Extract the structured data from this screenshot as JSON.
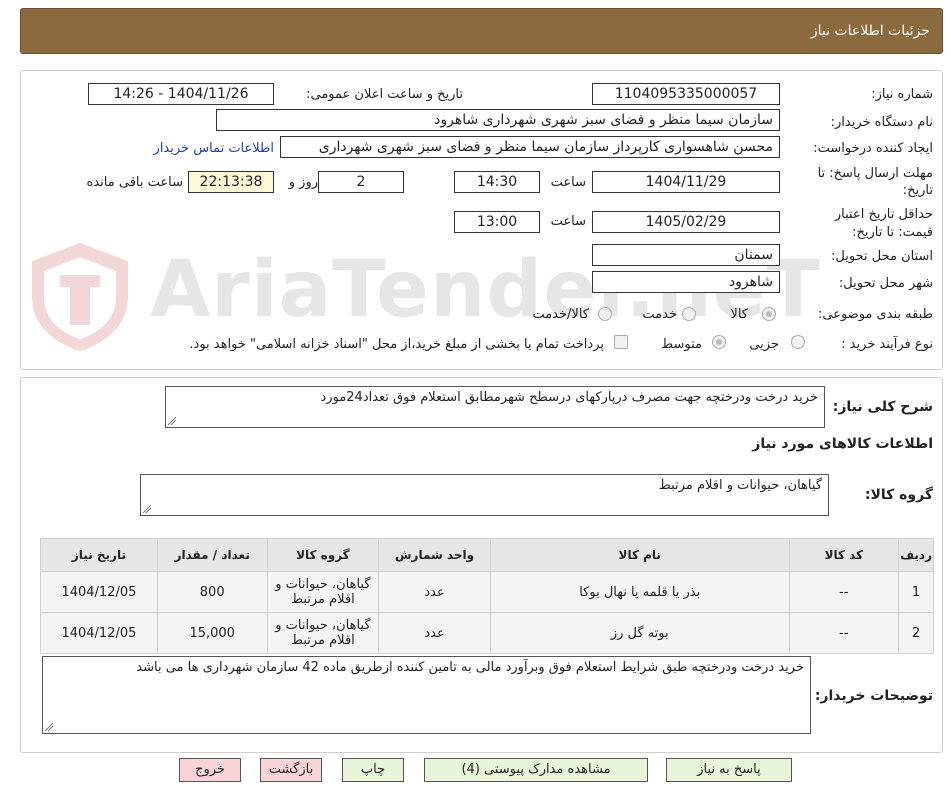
{
  "header": {
    "title": "جزئیات اطلاعات نیاز"
  },
  "form": {
    "need_number_label": "شماره نیاز:",
    "need_number": "1104095335000057",
    "announce_label": "تاریخ و ساعت اعلان عمومی:",
    "announce_value": "1404/11/26 - 14:26",
    "buyer_org_label": "نام دستگاه خریدار:",
    "buyer_org": "سازمان سیما منظر و فضای سبز شهری شهرداری شاهرود",
    "creator_label": "ایجاد کننده درخواست:",
    "creator": "محسن شاهسواری کارپرداز سازمان سیما منظر و فضای سبز شهری شهرداری",
    "contact_link": "اطلاعات تماس خریدار",
    "deadline_label_1": "مهلت ارسال پاسخ: تا",
    "deadline_label_2": "تاریخ:",
    "deadline_date": "1404/11/29",
    "time_label": "ساعت",
    "deadline_time": "14:30",
    "days_value": "2",
    "days_label": "روز و",
    "remaining_time": "22:13:38",
    "remaining_label": "ساعت باقی مانده",
    "validity_label_1": "حداقل تاریخ اعتبار",
    "validity_label_2": "قیمت: تا تاریخ:",
    "validity_date": "1405/02/29",
    "validity_time_label": "ساعت",
    "validity_time": "13:00",
    "province_label": "استان محل تحویل:",
    "province": "سمنان",
    "city_label": "شهر محل تحویل:",
    "city": "شاهرود",
    "category_label": "طبقه بندی موضوعی:",
    "category_options": [
      "کالا",
      "خدمت",
      "کالا/خدمت"
    ],
    "category_selected": "کالا",
    "process_label": "نوع فرآیند خرید :",
    "process_options": [
      "جزیی",
      "متوسط"
    ],
    "process_selected": "متوسط",
    "payment_note": "پرداخت تمام یا بخشی از مبلغ خرید،از محل \"اسناد خزانه اسلامی\" خواهد بود."
  },
  "summary": {
    "label": "شرح کلی نیاز:",
    "text": "خرید درخت ودرختچه جهت مصرف درپارکهای درسطح شهرمطابق استعلام فوق تعداد24مورد"
  },
  "goods": {
    "section_title": "اطلاعات کالاهای مورد نیاز",
    "group_label": "گروه کالا:",
    "group_value": "گیاهان، حیوانات و اقلام مرتبط"
  },
  "table": {
    "headers": [
      "ردیف",
      "کد کالا",
      "نام کالا",
      "واحد شمارش",
      "گروه کالا",
      "تعداد / مقدار",
      "تاریخ نیاز"
    ],
    "rows": [
      [
        "1",
        "--",
        "بذر یا قلمه یا نهال یوکا",
        "عدد",
        "گیاهان، حیوانات و اقلام مرتبط",
        "800",
        "1404/12/05"
      ],
      [
        "2",
        "--",
        "بوته گل رز",
        "عدد",
        "گیاهان، حیوانات و اقلام مرتبط",
        "15,000",
        "1404/12/05"
      ]
    ]
  },
  "buyer_notes": {
    "label": "توضیحات خریدار:",
    "text": "خرید درخت ودرختچه طبق شرایط استعلام فوق وبرآورد مالی به تامین کننده ازطریق ماده 42 سازمان شهرداری ها می باشد"
  },
  "buttons": {
    "reply": "پاسخ به نیاز",
    "docs": "مشاهده مدارک پیوستی (4)",
    "print": "چاپ",
    "back": "بازگشت",
    "exit": "خروج"
  },
  "watermark": {
    "text": "AriaTender.neT"
  },
  "colors": {
    "header_bg": "#8b6a3e",
    "link": "#1a3fbf",
    "button_green": "#e8f5d8",
    "button_pink": "#f8d3d8"
  }
}
